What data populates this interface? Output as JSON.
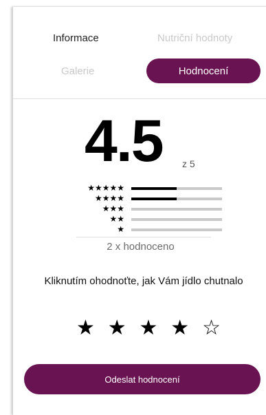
{
  "tabs": {
    "informace": "Informace",
    "nutricni": "Nutriční hodnoty",
    "galerie": "Galerie",
    "hodnoceni": "Hodnocení"
  },
  "rating": {
    "value": "4.5",
    "of_max": "z 5",
    "count_text": "2 x hodnoceno"
  },
  "histogram": [
    {
      "stars": "★★★★★",
      "fraction": 0.5
    },
    {
      "stars": "★★★★",
      "fraction": 0.5
    },
    {
      "stars": "★★★",
      "fraction": 0.0
    },
    {
      "stars": "★★",
      "fraction": 0.0
    },
    {
      "stars": "★",
      "fraction": 0.0
    }
  ],
  "rate_prompt": "Kliknutím ohodnoťte, jak Vám jídlo chutnalo",
  "user_rating": {
    "selected": 4,
    "max": 5,
    "filled_glyph": "★",
    "empty_glyph": "☆"
  },
  "submit_label": "Odeslat hodnocení",
  "colors": {
    "accent": "#6a1352",
    "inactive_tab": "#c9c9c9"
  }
}
